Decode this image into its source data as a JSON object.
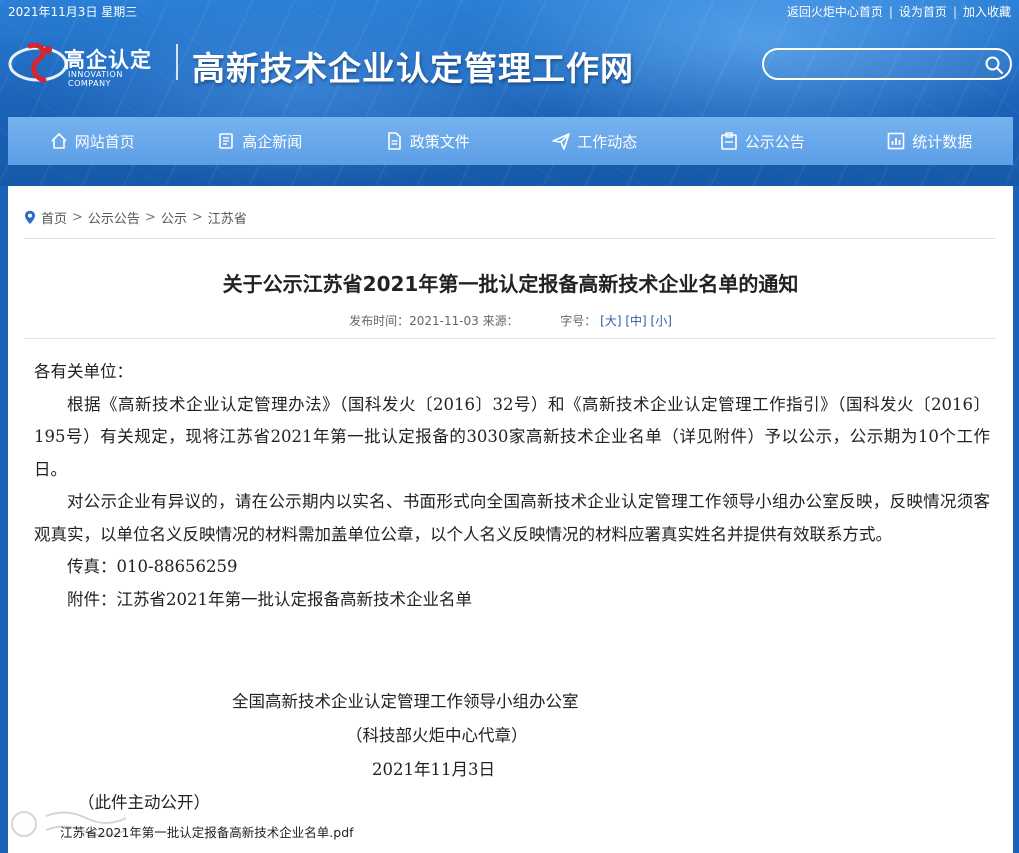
{
  "top_bar": {
    "date": "2021年11月3日 星期三",
    "links": [
      "返回火炬中心首页",
      "设为首页",
      "加入收藏"
    ]
  },
  "logo": {
    "name": "高企认定",
    "subtitle": "INNOVATION COMPANY"
  },
  "site_title": "高新技术企业认定管理工作网",
  "search": {
    "placeholder": ""
  },
  "nav": [
    {
      "label": "网站首页",
      "icon": "home-icon"
    },
    {
      "label": "高企新闻",
      "icon": "news-icon"
    },
    {
      "label": "政策文件",
      "icon": "document-icon"
    },
    {
      "label": "工作动态",
      "icon": "send-icon"
    },
    {
      "label": "公示公告",
      "icon": "clipboard-icon"
    },
    {
      "label": "统计数据",
      "icon": "chart-icon"
    }
  ],
  "breadcrumb": [
    "首页",
    "公示公告",
    "公示",
    "江苏省"
  ],
  "article": {
    "title": "关于公示江苏省2021年第一批认定报备高新技术企业名单的通知",
    "meta": {
      "publish": "发布时间：2021-11-03 来源：",
      "size_label": "字号：",
      "sizes": [
        "[大]",
        "[中]",
        "[小]"
      ]
    },
    "salutation": "各有关单位：",
    "paragraphs": [
      "根据《高新技术企业认定管理办法》（国科发火〔2016〕32号）和《高新技术企业认定管理工作指引》（国科发火〔2016〕195号）有关规定，现将江苏省2021年第一批认定报备的3030家高新技术企业名单（详见附件）予以公示，公示期为10个工作日。",
      "对公示企业有异议的，请在公示期内以实名、书面形式向全国高新技术企业认定管理工作领导小组办公室反映，反映情况须客观真实，以单位名义反映情况的材料需加盖单位公章，以个人名义反映情况的材料应署真实姓名并提供有效联系方式。"
    ],
    "fax": "传真：010-88656259",
    "attachment_line": "附件：江苏省2021年第一批认定报备高新技术企业名单",
    "signature": {
      "org": "全国高新技术企业认定管理工作领导小组办公室",
      "sub": "（科技部火炬中心代章）",
      "date": "2021年11月3日"
    },
    "public_note": "（此件主动公开）",
    "attachment_file": "江苏省2021年第一批认定报备高新技术企业名单.pdf"
  },
  "colors": {
    "header_blue": "#1b63b8",
    "nav_blue": "#6aa8ec",
    "link_blue": "#2b5fa6",
    "logo_red": "#d9232d"
  }
}
